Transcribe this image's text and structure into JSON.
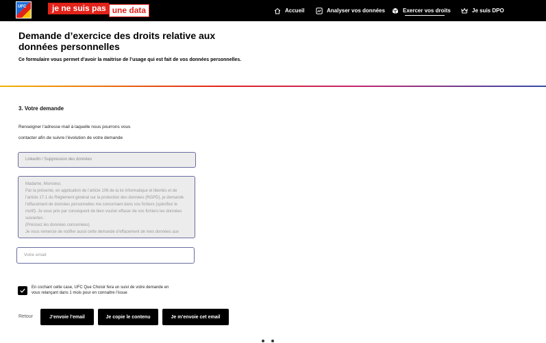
{
  "header": {
    "logo_text": "UFC",
    "brand_part1": "je ne suis pas",
    "brand_part2": "une data",
    "nav": [
      {
        "label": "Accueil",
        "icon": "home-icon"
      },
      {
        "label": "Analyser vos données",
        "icon": "chart-icon"
      },
      {
        "label": "Exercer vos droits",
        "icon": "cube-icon",
        "active": true
      },
      {
        "label": "Je suis DPO",
        "icon": "crown-icon"
      }
    ]
  },
  "page": {
    "title": "Demande d’exercice des droits relative aux données personnelles",
    "subtitle": "Ce formulaire vous permet d’avoir la maitrise de l’usage qui est fait de vos données personnelles."
  },
  "form": {
    "section_title": "3. Votre demande",
    "description_line1": "Renseigner l’adresse mail à laquelle nous pourrons vous",
    "description_line2": "contacter afin de suivre l’évolution de votre demande",
    "subject_placeholder": "LinkedIn / Suppression des données",
    "message_lines": [
      "Madame, Monsieur,",
      "Par la présente, en application de l’article 106 de la loi Informatique et libertés et de",
      "l’article 17-1 du Règlement général sur la protection des données (RGPD), je demande",
      "l’effacement de données personnelles me concernant dans vos fichiers (spécifiez le",
      "motif). Je vous prie par conséquent de bien vouloir effacer de vos fichiers les données",
      "suivantes :",
      "(Précisez les données concernées)",
      "Je vous remercie de notifier aussi cette demande d’effacement de mes données aux"
    ],
    "email_placeholder": "Votre email",
    "consent_checked": true,
    "consent_text": "En cochant cette case, UFC Que Choisir fera un suivi de votre demande en vous relançant dans 1 mois pour en connaitre l’issue",
    "back_label": "Retour",
    "buttons": {
      "send_email": "J’envoie l’email",
      "copy_content": "Je copie le contenu",
      "send_me": "Je m’envoie cet email"
    }
  },
  "colors": {
    "header_bg": "#000000",
    "brand_red": "#e2231a",
    "field_border": "#6a6aa0",
    "field_bg": "#ececec"
  }
}
